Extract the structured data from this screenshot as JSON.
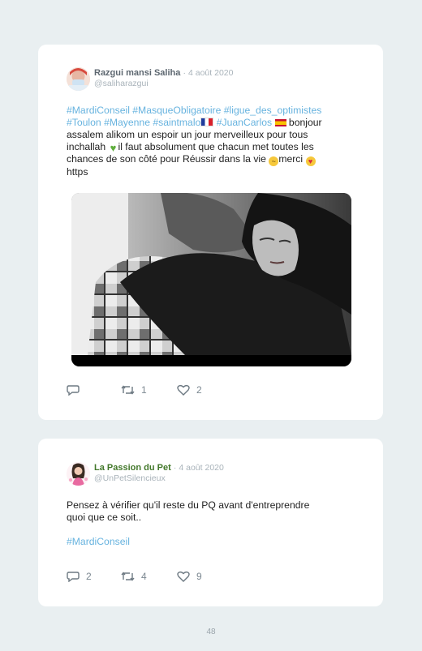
{
  "tweets": [
    {
      "user_name": "Razgui mansi Saliha",
      "separator": "·",
      "date": "4 août 2020",
      "handle": "@saliharazgui",
      "lines": {
        "l1_tags": "#MardiConseil #MasqueObligatoire #ligue_des_optimistes",
        "l2_tags_a": "#Toulon #Mayenne #saintmalo",
        "l2_tags_b": "#JuanCarlos",
        "l2_text": " bonjour",
        "l3": "assalem alikom un espoir un jour merveilleux pour tous",
        "l4_a": "inchallah ",
        "l4_b": "il faut absolument que chacun met toutes les",
        "l5_a": "chances de son côté pour Réussir dans la vie ",
        "l5_b": "merci ",
        "l6": "https"
      },
      "emoji": {
        "heart": "♥",
        "cry": "~",
        "kiss": "♥"
      },
      "flags": [
        "flag-france",
        "flag-spain"
      ],
      "media": "black-and-white-hug-gif",
      "replies": "",
      "retweets": "1",
      "likes": "2"
    },
    {
      "user_name": "La Passion du Pet",
      "separator": "·",
      "date": "4 août 2020",
      "handle": "@UnPetSilencieux",
      "text_l1": "Pensez à vérifier qu'il reste du PQ avant d'entreprendre",
      "text_l2": "quoi que ce soit..",
      "tags": "#MardiConseil",
      "replies": "2",
      "retweets": "4",
      "likes": "9"
    }
  ],
  "icons": [
    "reply-icon",
    "retweet-icon",
    "like-icon"
  ],
  "colors": {
    "background": "#e9eff1",
    "card": "#ffffff",
    "hashtag": "#67b3df",
    "meta": "#a9b3ba"
  },
  "page_number": "48"
}
